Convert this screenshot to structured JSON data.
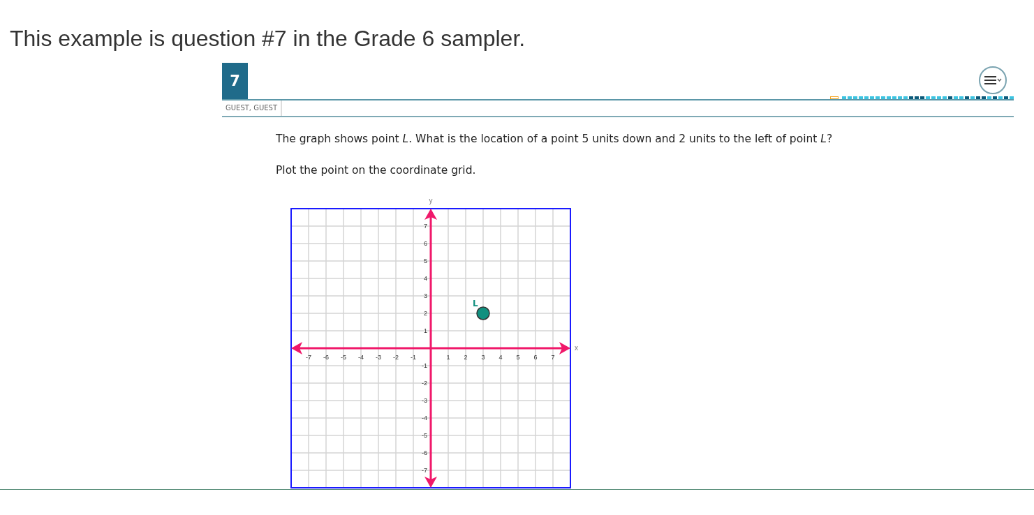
{
  "page_title": "This example is question #7 in the Grade 6 sampler.",
  "question": {
    "number": "7",
    "user": "GUEST, GUEST",
    "progress": [
      {
        "kind": "current"
      },
      {
        "kind": "unvisited"
      },
      {
        "kind": "unvisited"
      },
      {
        "kind": "unvisited"
      },
      {
        "kind": "unvisited"
      },
      {
        "kind": "unvisited"
      },
      {
        "kind": "unvisited"
      },
      {
        "kind": "unvisited"
      },
      {
        "kind": "unvisited"
      },
      {
        "kind": "unvisited"
      },
      {
        "kind": "unvisited"
      },
      {
        "kind": "unvisited"
      },
      {
        "kind": "unvisited"
      },
      {
        "kind": "visited"
      },
      {
        "kind": "visited"
      },
      {
        "kind": "visited"
      },
      {
        "kind": "unvisited"
      },
      {
        "kind": "unvisited"
      },
      {
        "kind": "unvisited"
      },
      {
        "kind": "unvisited"
      },
      {
        "kind": "visited"
      },
      {
        "kind": "unvisited"
      },
      {
        "kind": "unvisited"
      },
      {
        "kind": "visited"
      },
      {
        "kind": "unvisited"
      },
      {
        "kind": "visited"
      },
      {
        "kind": "visited"
      },
      {
        "kind": "unvisited"
      },
      {
        "kind": "visited"
      },
      {
        "kind": "unvisited"
      },
      {
        "kind": "visited"
      },
      {
        "kind": "unvisited"
      }
    ],
    "prompt": "The graph shows point *L*. What is the location of a point 5 units down and 2 units to the left of point *L*?",
    "instruction": "Plot the point on the coordinate grid.",
    "graph": {
      "chart_data": {
        "type": "scatter",
        "grid": true,
        "xlabel": "x",
        "ylabel": "y",
        "xlim": [
          -8,
          8
        ],
        "ylim": [
          -8,
          8
        ],
        "xticks": [
          -7,
          -6,
          -5,
          -4,
          -3,
          -2,
          -1,
          1,
          2,
          3,
          4,
          5,
          6,
          7
        ],
        "yticks": [
          -7,
          -6,
          -5,
          -4,
          -3,
          -2,
          -1,
          1,
          2,
          3,
          4,
          5,
          6,
          7
        ],
        "series": [
          {
            "name": "L",
            "color": "#11907f",
            "x": [
              3
            ],
            "values": [
              2
            ]
          }
        ]
      }
    }
  }
}
